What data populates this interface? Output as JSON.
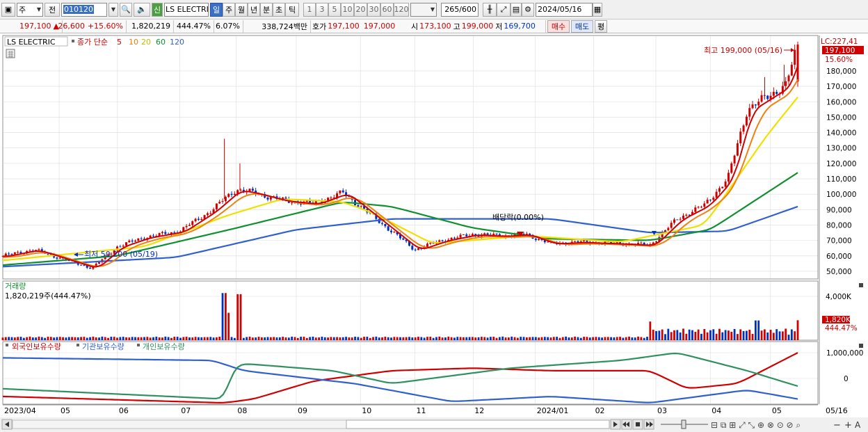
{
  "toolbar": {
    "period_type": "주",
    "prev_label": "전",
    "code": "010120",
    "name": "LS ELECTRI",
    "new_badge": "신",
    "periods": [
      "일",
      "주",
      "월",
      "년",
      "분",
      "초",
      "틱"
    ],
    "active_period": "일",
    "minutes": [
      "1",
      "3",
      "5",
      "10",
      "20",
      "30",
      "60",
      "120"
    ],
    "count": "265",
    "count_total": "/600",
    "date": "2024/05/16"
  },
  "quote": {
    "price": "197,100",
    "change": "26,600",
    "change_pct": "+15.60%",
    "volume": "1,820,219",
    "volume_ratio": "444.47%",
    "turnover": "6.07%",
    "amount": "338,724백만",
    "ask_label": "호가",
    "ask": "197,100",
    "bid": "197,000",
    "open_label": "시",
    "open": "173,100",
    "high_label": "고",
    "high": "199,000",
    "low_label": "저",
    "low": "169,700",
    "buy_label": "매수",
    "sell_label": "매도",
    "avg_label": "평"
  },
  "price_panel": {
    "title": "LS ELECTRIC",
    "ma_prefix": "종가 단순",
    "ma_periods": [
      "5",
      "10",
      "20",
      "60",
      "120"
    ],
    "lc_label": "LC:227,41",
    "last_price": "197,100",
    "last_pct": "15.60%",
    "high_annotation": "최고 199,000 (05/16)",
    "low_annotation": "최저 50,200 (05/19)",
    "dividend_annotation": "배당락(0.00%)",
    "y_ticks": [
      "180,000",
      "170,000",
      "160,000",
      "150,000",
      "140,000",
      "130,000",
      "120,000",
      "110,000",
      "100,000",
      "90,000",
      "80,000",
      "70,000",
      "60,000",
      "50,000"
    ]
  },
  "volume_panel": {
    "title": "거래량",
    "value": "1,820,219주(444.47%)",
    "y_tick": "4,000K",
    "last_value": "1,820K",
    "last_pct": "444.47%"
  },
  "holding_panel": {
    "legend": [
      "외국인보유수량",
      "기관보유수량",
      "개인보유수량"
    ],
    "y_ticks": [
      "1,000,000",
      "0"
    ]
  },
  "x_axis": {
    "labels": [
      "2023/04",
      "05",
      "06",
      "07",
      "08",
      "09",
      "10",
      "11",
      "12",
      "2024/01",
      "02",
      "03",
      "04",
      "05"
    ],
    "right_label": "05/16"
  },
  "colors": {
    "ma5": "#d00000",
    "ma10": "#f08010",
    "ma20": "#f0e000",
    "ma60": "#109030",
    "ma120": "#3060d0",
    "up": "#d00000",
    "down": "#0030c0",
    "foreign": "#d00000",
    "institution": "#3060d0",
    "individual": "#309060"
  },
  "chart_data": {
    "type": "line",
    "ylim": [
      45000,
      203000
    ],
    "close": [
      {
        "x": "2023-04-03",
        "y": 60000
      },
      {
        "x": "2023-04-19",
        "y": 64000
      },
      {
        "x": "2023-05-19",
        "y": 52000
      },
      {
        "x": "2023-06-01",
        "y": 66000
      },
      {
        "x": "2023-06-15",
        "y": 72000
      },
      {
        "x": "2023-07-03",
        "y": 76000
      },
      {
        "x": "2023-07-20",
        "y": 90000
      },
      {
        "x": "2023-07-27",
        "y": 98000
      },
      {
        "x": "2023-08-01",
        "y": 103000
      },
      {
        "x": "2023-08-10",
        "y": 101000
      },
      {
        "x": "2023-08-25",
        "y": 96000
      },
      {
        "x": "2023-09-10",
        "y": 94000
      },
      {
        "x": "2023-09-25",
        "y": 101000
      },
      {
        "x": "2023-10-05",
        "y": 91000
      },
      {
        "x": "2023-10-20",
        "y": 76000
      },
      {
        "x": "2023-11-01",
        "y": 64000
      },
      {
        "x": "2023-11-15",
        "y": 70000
      },
      {
        "x": "2023-12-01",
        "y": 74000
      },
      {
        "x": "2023-12-15",
        "y": 73000
      },
      {
        "x": "2023-12-28",
        "y": 74000
      },
      {
        "x": "2024-01-10",
        "y": 68000
      },
      {
        "x": "2024-01-25",
        "y": 69000
      },
      {
        "x": "2024-02-15",
        "y": 68000
      },
      {
        "x": "2024-03-01",
        "y": 67000
      },
      {
        "x": "2024-03-15",
        "y": 84000
      },
      {
        "x": "2024-03-29",
        "y": 93000
      },
      {
        "x": "2024-04-10",
        "y": 110000
      },
      {
        "x": "2024-04-20",
        "y": 155000
      },
      {
        "x": "2024-04-30",
        "y": 163000
      },
      {
        "x": "2024-05-10",
        "y": 171000
      },
      {
        "x": "2024-05-16",
        "y": 197100
      }
    ],
    "ma20": [
      {
        "x": "2023-04-03",
        "y": 57000
      },
      {
        "x": "2023-06-15",
        "y": 66000
      },
      {
        "x": "2023-07-27",
        "y": 86000
      },
      {
        "x": "2023-08-25",
        "y": 97000
      },
      {
        "x": "2023-09-25",
        "y": 95000
      },
      {
        "x": "2023-10-10",
        "y": 88000
      },
      {
        "x": "2023-11-10",
        "y": 68000
      },
      {
        "x": "2023-12-28",
        "y": 73000
      },
      {
        "x": "2024-02-15",
        "y": 69000
      },
      {
        "x": "2024-03-29",
        "y": 80000
      },
      {
        "x": "2024-04-30",
        "y": 138000
      },
      {
        "x": "2024-05-16",
        "y": 163000
      }
    ],
    "ma60": [
      {
        "x": "2023-04-03",
        "y": 54000
      },
      {
        "x": "2023-06-01",
        "y": 60000
      },
      {
        "x": "2023-08-01",
        "y": 78000
      },
      {
        "x": "2023-09-25",
        "y": 95000
      },
      {
        "x": "2023-10-20",
        "y": 92000
      },
      {
        "x": "2023-12-01",
        "y": 78000
      },
      {
        "x": "2024-01-10",
        "y": 71000
      },
      {
        "x": "2024-03-01",
        "y": 70000
      },
      {
        "x": "2024-04-01",
        "y": 77000
      },
      {
        "x": "2024-05-16",
        "y": 114000
      }
    ],
    "ma120": [
      {
        "x": "2023-04-03",
        "y": 53000
      },
      {
        "x": "2023-07-01",
        "y": 59000
      },
      {
        "x": "2023-09-01",
        "y": 77000
      },
      {
        "x": "2023-10-20",
        "y": 84000
      },
      {
        "x": "2024-01-10",
        "y": 84000
      },
      {
        "x": "2024-03-01",
        "y": 75000
      },
      {
        "x": "2024-04-10",
        "y": 76000
      },
      {
        "x": "2024-05-16",
        "y": 92000
      }
    ],
    "volume_k": [
      {
        "x": "2023-07-26",
        "y": 4300
      },
      {
        "x": "2023-07-28",
        "y": 2500
      },
      {
        "x": "2023-08-03",
        "y": 4200
      },
      {
        "x": "2024-03-01",
        "y": 1700
      },
      {
        "x": "2024-04-25",
        "y": 1800
      },
      {
        "x": "2024-05-16",
        "y": 1820
      }
    ],
    "holdings": [
      {
        "name": "외국인보유수량",
        "points": [
          {
            "x": "2023-04-03",
            "y": -700000
          },
          {
            "x": "2023-07-26",
            "y": -950000
          },
          {
            "x": "2023-08-10",
            "y": -800000
          },
          {
            "x": "2023-09-10",
            "y": -100000
          },
          {
            "x": "2023-10-20",
            "y": 300000
          },
          {
            "x": "2023-12-01",
            "y": 400000
          },
          {
            "x": "2024-01-10",
            "y": 300000
          },
          {
            "x": "2024-03-01",
            "y": 300000
          },
          {
            "x": "2024-03-20",
            "y": -400000
          },
          {
            "x": "2024-04-15",
            "y": -200000
          },
          {
            "x": "2024-05-16",
            "y": 1000000
          }
        ]
      },
      {
        "name": "기관보유수량",
        "points": [
          {
            "x": "2023-04-03",
            "y": 800000
          },
          {
            "x": "2023-07-20",
            "y": 700000
          },
          {
            "x": "2023-08-05",
            "y": 300000
          },
          {
            "x": "2023-10-01",
            "y": -200000
          },
          {
            "x": "2023-11-20",
            "y": -900000
          },
          {
            "x": "2024-01-10",
            "y": -700000
          },
          {
            "x": "2024-03-01",
            "y": -950000
          },
          {
            "x": "2024-04-20",
            "y": -450000
          },
          {
            "x": "2024-05-16",
            "y": -800000
          }
        ]
      },
      {
        "name": "개인보유수량",
        "points": [
          {
            "x": "2023-04-03",
            "y": -400000
          },
          {
            "x": "2023-07-26",
            "y": -800000
          },
          {
            "x": "2023-08-01",
            "y": 600000
          },
          {
            "x": "2023-09-20",
            "y": 300000
          },
          {
            "x": "2023-10-20",
            "y": -200000
          },
          {
            "x": "2023-12-20",
            "y": 400000
          },
          {
            "x": "2024-02-15",
            "y": 700000
          },
          {
            "x": "2024-03-15",
            "y": 1000000
          },
          {
            "x": "2024-04-20",
            "y": 300000
          },
          {
            "x": "2024-05-16",
            "y": -300000
          }
        ]
      }
    ]
  }
}
